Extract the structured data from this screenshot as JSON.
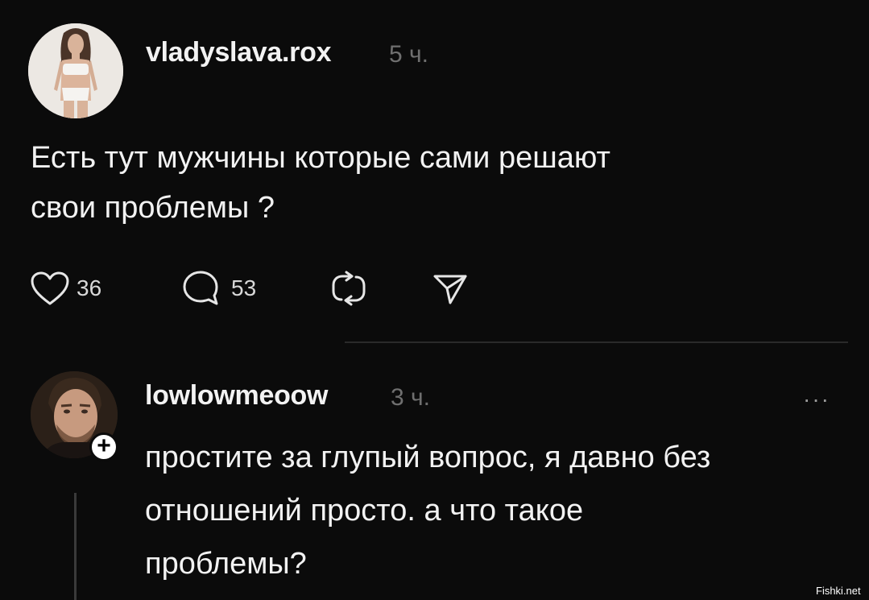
{
  "post": {
    "username": "vladyslava.rox",
    "time": "5 ч.",
    "text_line1": "Есть тут мужчины которые сами решают",
    "text_line2": "свои проблемы ?",
    "likes": "36",
    "comments": "53",
    "icons": [
      "heart-icon",
      "comment-icon",
      "repost-icon",
      "share-icon"
    ]
  },
  "reply": {
    "username": "lowlowmeoow",
    "time": "3 ч.",
    "more": "···",
    "text_line1": "простите за глупый вопрос, я давно без",
    "text_line2": "отношений просто. а что такое",
    "text_line3": "проблемы?"
  },
  "watermark": "Fishki.net",
  "colors": {
    "background": "#0b0b0b",
    "text": "#f2f2f2",
    "muted": "#6f6f6f"
  }
}
